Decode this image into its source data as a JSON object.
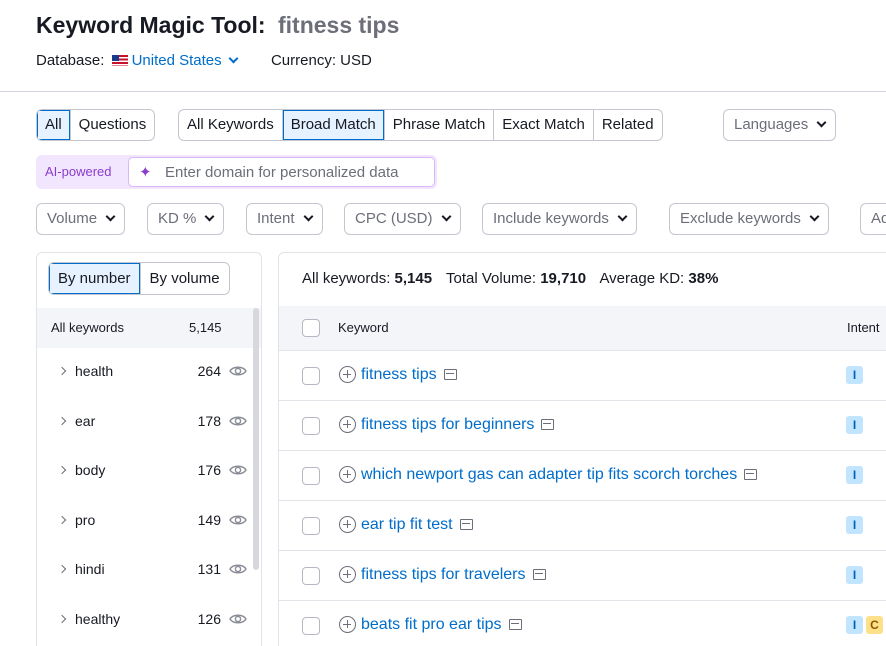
{
  "header": {
    "title": "Keyword Magic Tool:",
    "query": "fitness tips",
    "database_label": "Database:",
    "database_value": "United States",
    "currency": "Currency: USD"
  },
  "match_tabs": {
    "type": [
      "All",
      "Questions"
    ],
    "match": [
      "All Keywords",
      "Broad Match",
      "Phrase Match",
      "Exact Match",
      "Related"
    ],
    "languages": "Languages"
  },
  "ai": {
    "label": "AI-powered",
    "placeholder": "Enter domain for personalized data"
  },
  "filters": [
    "Volume",
    "KD %",
    "Intent",
    "CPC (USD)",
    "Include keywords",
    "Exclude keywords",
    "Ad"
  ],
  "groups": {
    "toggle": [
      "By number",
      "By volume"
    ],
    "all_label": "All keywords",
    "all_count": "5,145",
    "items": [
      {
        "label": "health",
        "count": "264"
      },
      {
        "label": "ear",
        "count": "178"
      },
      {
        "label": "body",
        "count": "176"
      },
      {
        "label": "pro",
        "count": "149"
      },
      {
        "label": "hindi",
        "count": "131"
      },
      {
        "label": "healthy",
        "count": "126"
      }
    ]
  },
  "summary": {
    "all_label": "All keywords:",
    "all_value": "5,145",
    "volume_label": "Total Volume:",
    "volume_value": "19,710",
    "kd_label": "Average KD:",
    "kd_value": "38%"
  },
  "table": {
    "col_keyword": "Keyword",
    "col_intent": "Intent",
    "rows": [
      {
        "keyword": "fitness tips",
        "intents": [
          "I"
        ]
      },
      {
        "keyword": "fitness tips for beginners",
        "intents": [
          "I"
        ]
      },
      {
        "keyword": "which newport gas can adapter tip fits scorch torches",
        "intents": [
          "I"
        ]
      },
      {
        "keyword": "ear tip fit test",
        "intents": [
          "I"
        ]
      },
      {
        "keyword": "fitness tips for travelers",
        "intents": [
          "I"
        ]
      },
      {
        "keyword": "beats fit pro ear tips",
        "intents": [
          "I",
          "C"
        ]
      }
    ]
  },
  "colors": {
    "accent": "#006dca",
    "ai_purple": "#8a3ccc",
    "intent_informational": "#c2e5ff",
    "intent_commercial": "#ffe08a"
  },
  "icons": {
    "flag": "us-flag-icon",
    "dropdown": "chevron-down-icon",
    "ai": "sparkle-icon",
    "eye": "eye-icon",
    "expand": "chevron-right-icon",
    "add": "plus-circle-icon",
    "serp": "serp-icon"
  }
}
